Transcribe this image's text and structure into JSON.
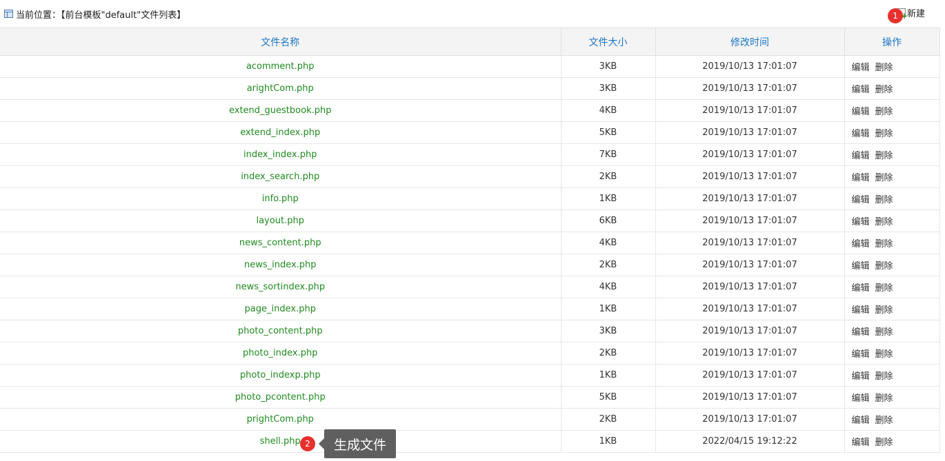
{
  "breadcrumb": {
    "icon": "table-icon",
    "text": "当前位置：【前台模板\"default\"文件列表】"
  },
  "new_button": {
    "icon": "new-file-icon",
    "label": "新建"
  },
  "table": {
    "headers": [
      "文件名称",
      "文件大小",
      "修改时间",
      "操作"
    ],
    "rows": [
      {
        "name": "acomment.php",
        "size": "3KB",
        "time": "2019/10/13 17:01:07",
        "edit": "编辑",
        "del": "删除"
      },
      {
        "name": "arightCom.php",
        "size": "3KB",
        "time": "2019/10/13 17:01:07",
        "edit": "编辑",
        "del": "删除"
      },
      {
        "name": "extend_guestbook.php",
        "size": "4KB",
        "time": "2019/10/13 17:01:07",
        "edit": "编辑",
        "del": "删除"
      },
      {
        "name": "extend_index.php",
        "size": "5KB",
        "time": "2019/10/13 17:01:07",
        "edit": "编辑",
        "del": "删除"
      },
      {
        "name": "index_index.php",
        "size": "7KB",
        "time": "2019/10/13 17:01:07",
        "edit": "编辑",
        "del": "删除"
      },
      {
        "name": "index_search.php",
        "size": "2KB",
        "time": "2019/10/13 17:01:07",
        "edit": "编辑",
        "del": "删除"
      },
      {
        "name": "info.php",
        "size": "1KB",
        "time": "2019/10/13 17:01:07",
        "edit": "编辑",
        "del": "删除"
      },
      {
        "name": "layout.php",
        "size": "6KB",
        "time": "2019/10/13 17:01:07",
        "edit": "编辑",
        "del": "删除"
      },
      {
        "name": "news_content.php",
        "size": "4KB",
        "time": "2019/10/13 17:01:07",
        "edit": "编辑",
        "del": "删除"
      },
      {
        "name": "news_index.php",
        "size": "2KB",
        "time": "2019/10/13 17:01:07",
        "edit": "编辑",
        "del": "删除"
      },
      {
        "name": "news_sortindex.php",
        "size": "4KB",
        "time": "2019/10/13 17:01:07",
        "edit": "编辑",
        "del": "删除"
      },
      {
        "name": "page_index.php",
        "size": "1KB",
        "time": "2019/10/13 17:01:07",
        "edit": "编辑",
        "del": "删除"
      },
      {
        "name": "photo_content.php",
        "size": "3KB",
        "time": "2019/10/13 17:01:07",
        "edit": "编辑",
        "del": "删除"
      },
      {
        "name": "photo_index.php",
        "size": "2KB",
        "time": "2019/10/13 17:01:07",
        "edit": "编辑",
        "del": "删除"
      },
      {
        "name": "photo_indexp.php",
        "size": "1KB",
        "time": "2019/10/13 17:01:07",
        "edit": "编辑",
        "del": "删除"
      },
      {
        "name": "photo_pcontent.php",
        "size": "5KB",
        "time": "2019/10/13 17:01:07",
        "edit": "编辑",
        "del": "删除"
      },
      {
        "name": "prightCom.php",
        "size": "2KB",
        "time": "2019/10/13 17:01:07",
        "edit": "编辑",
        "del": "删除"
      },
      {
        "name": "shell.php",
        "size": "1KB",
        "time": "2022/04/15 19:12:22",
        "edit": "编辑",
        "del": "删除"
      }
    ]
  },
  "annotations": {
    "badge1": "1",
    "badge2": "2",
    "tooltip": "生成文件",
    "badge_color": "#e8302d"
  }
}
